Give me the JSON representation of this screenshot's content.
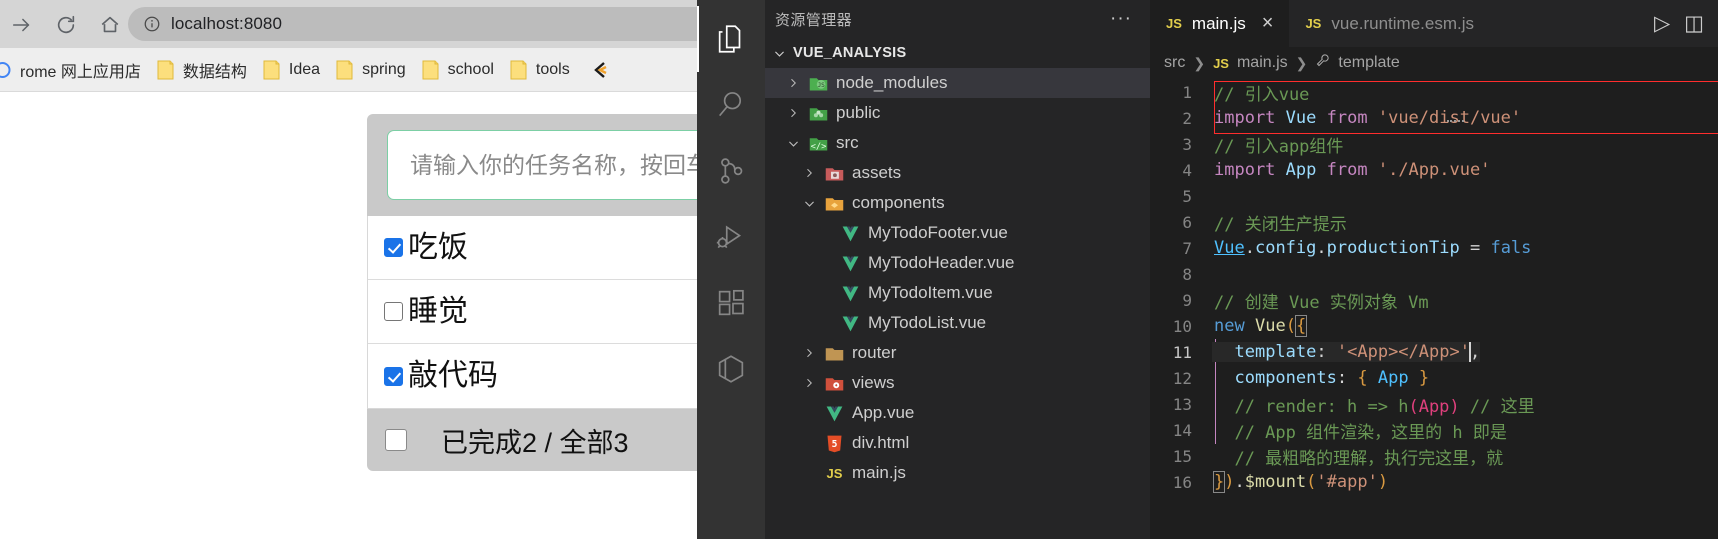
{
  "browser": {
    "nav": {
      "forward_icon": "arrow-right-icon",
      "reload_icon": "reload-icon",
      "home_icon": "home-icon"
    },
    "omnibox": {
      "info_icon": "info-circle-icon",
      "url": "localhost:8080"
    },
    "bookmarks": [
      {
        "label": "rome 网上应用店",
        "icon": "chrome-webstore-icon"
      },
      {
        "label": "数据结构",
        "icon": "folder-icon"
      },
      {
        "label": "Idea",
        "icon": "folder-icon"
      },
      {
        "label": "spring",
        "icon": "folder-icon"
      },
      {
        "label": "school",
        "icon": "folder-icon"
      },
      {
        "label": "tools",
        "icon": "folder-icon"
      },
      {
        "label": "",
        "icon": "partial-bookmark-icon"
      }
    ],
    "page": {
      "input_placeholder": "请输入你的任务名称，按回车",
      "input_value": "",
      "todos": [
        {
          "text": "吃饭",
          "done": true
        },
        {
          "text": "睡觉",
          "done": false
        },
        {
          "text": "敲代码",
          "done": true
        }
      ],
      "footer": {
        "toggle_all_checked": false,
        "summary": "已完成2 / 全部3"
      }
    }
  },
  "vscode": {
    "activitybar": [
      {
        "name": "explorer-icon",
        "active": true
      },
      {
        "name": "search-icon",
        "active": false
      },
      {
        "name": "source-control-icon",
        "active": false
      },
      {
        "name": "run-debug-icon",
        "active": false
      },
      {
        "name": "extensions-icon",
        "active": false
      },
      {
        "name": "remote-explorer-icon",
        "active": false
      }
    ],
    "sidebar": {
      "title": "资源管理器",
      "more_actions": "···",
      "root_folder": "VUE_ANALYSIS",
      "tree": [
        {
          "label": "node_modules",
          "indent": 0,
          "arrow": "collapsed",
          "icon": "node-modules-folder-icon",
          "selected": true
        },
        {
          "label": "public",
          "indent": 0,
          "arrow": "collapsed",
          "icon": "public-folder-icon",
          "selected": false
        },
        {
          "label": "src",
          "indent": 0,
          "arrow": "expanded",
          "icon": "src-folder-icon",
          "selected": false
        },
        {
          "label": "assets",
          "indent": 1,
          "arrow": "collapsed",
          "icon": "assets-folder-icon",
          "selected": false
        },
        {
          "label": "components",
          "indent": 1,
          "arrow": "expanded",
          "icon": "components-folder-icon",
          "selected": false
        },
        {
          "label": "MyTodoFooter.vue",
          "indent": 2,
          "arrow": "none",
          "icon": "vue-file-icon",
          "selected": false
        },
        {
          "label": "MyTodoHeader.vue",
          "indent": 2,
          "arrow": "none",
          "icon": "vue-file-icon",
          "selected": false
        },
        {
          "label": "MyTodoItem.vue",
          "indent": 2,
          "arrow": "none",
          "icon": "vue-file-icon",
          "selected": false
        },
        {
          "label": "MyTodoList.vue",
          "indent": 2,
          "arrow": "none",
          "icon": "vue-file-icon",
          "selected": false
        },
        {
          "label": "router",
          "indent": 1,
          "arrow": "collapsed",
          "icon": "router-folder-icon",
          "selected": false
        },
        {
          "label": "views",
          "indent": 1,
          "arrow": "collapsed",
          "icon": "views-folder-icon",
          "selected": false
        },
        {
          "label": "App.vue",
          "indent": 1,
          "arrow": "none",
          "icon": "vue-file-icon",
          "selected": false
        },
        {
          "label": "div.html",
          "indent": 1,
          "arrow": "none",
          "icon": "html5-file-icon",
          "selected": false
        },
        {
          "label": "main.js",
          "indent": 1,
          "arrow": "none",
          "icon": "js-file-icon",
          "selected": false
        }
      ]
    },
    "editor": {
      "tabs": [
        {
          "badge": "JS",
          "label": "main.js",
          "active": true,
          "close": "×"
        },
        {
          "badge": "JS",
          "label": "vue.runtime.esm.js",
          "active": false,
          "close": ""
        }
      ],
      "actions": [
        {
          "name": "run-code-icon",
          "glyph": "▷"
        },
        {
          "name": "split-editor-icon",
          "glyph": "◫"
        }
      ],
      "breadcrumb": [
        {
          "label": "src",
          "icon": ""
        },
        {
          "label": "main.js",
          "icon": "JS"
        },
        {
          "label": "template",
          "icon": "wrench-icon"
        }
      ],
      "lines": [
        {
          "n": "1",
          "text": "// 引入vue"
        },
        {
          "n": "2",
          "text": "import Vue from 'vue/dist/vue'"
        },
        {
          "n": "3",
          "text": "// 引入app组件"
        },
        {
          "n": "4",
          "text": "import App from './App.vue'"
        },
        {
          "n": "5",
          "text": ""
        },
        {
          "n": "6",
          "text": "// 关闭生产提示"
        },
        {
          "n": "7",
          "text": "Vue.config.productionTip = fals"
        },
        {
          "n": "8",
          "text": ""
        },
        {
          "n": "9",
          "text": "// 创建 Vue 实例对象 Vm"
        },
        {
          "n": "10",
          "text": "new Vue({"
        },
        {
          "n": "11",
          "text": "  template: '<App></App>',"
        },
        {
          "n": "12",
          "text": "  components: { App }"
        },
        {
          "n": "13",
          "text": "  // render: h => h(App) // 这里"
        },
        {
          "n": "14",
          "text": "  // App 组件渲染，这里的 h 即是"
        },
        {
          "n": "15",
          "text": "  // 最粗略的理解，执行完这里，就"
        },
        {
          "n": "16",
          "text": "}).$mount('#app')"
        }
      ],
      "active_line": "11"
    }
  },
  "colors": {
    "vscode_bg": "#1e1e1e",
    "sidebar_bg": "#252526",
    "activitybar_bg": "#333333",
    "accent_red_box": "#ff2d2d",
    "checkbox_blue": "#1a73e8",
    "input_border_green": "#7ccfa5"
  }
}
